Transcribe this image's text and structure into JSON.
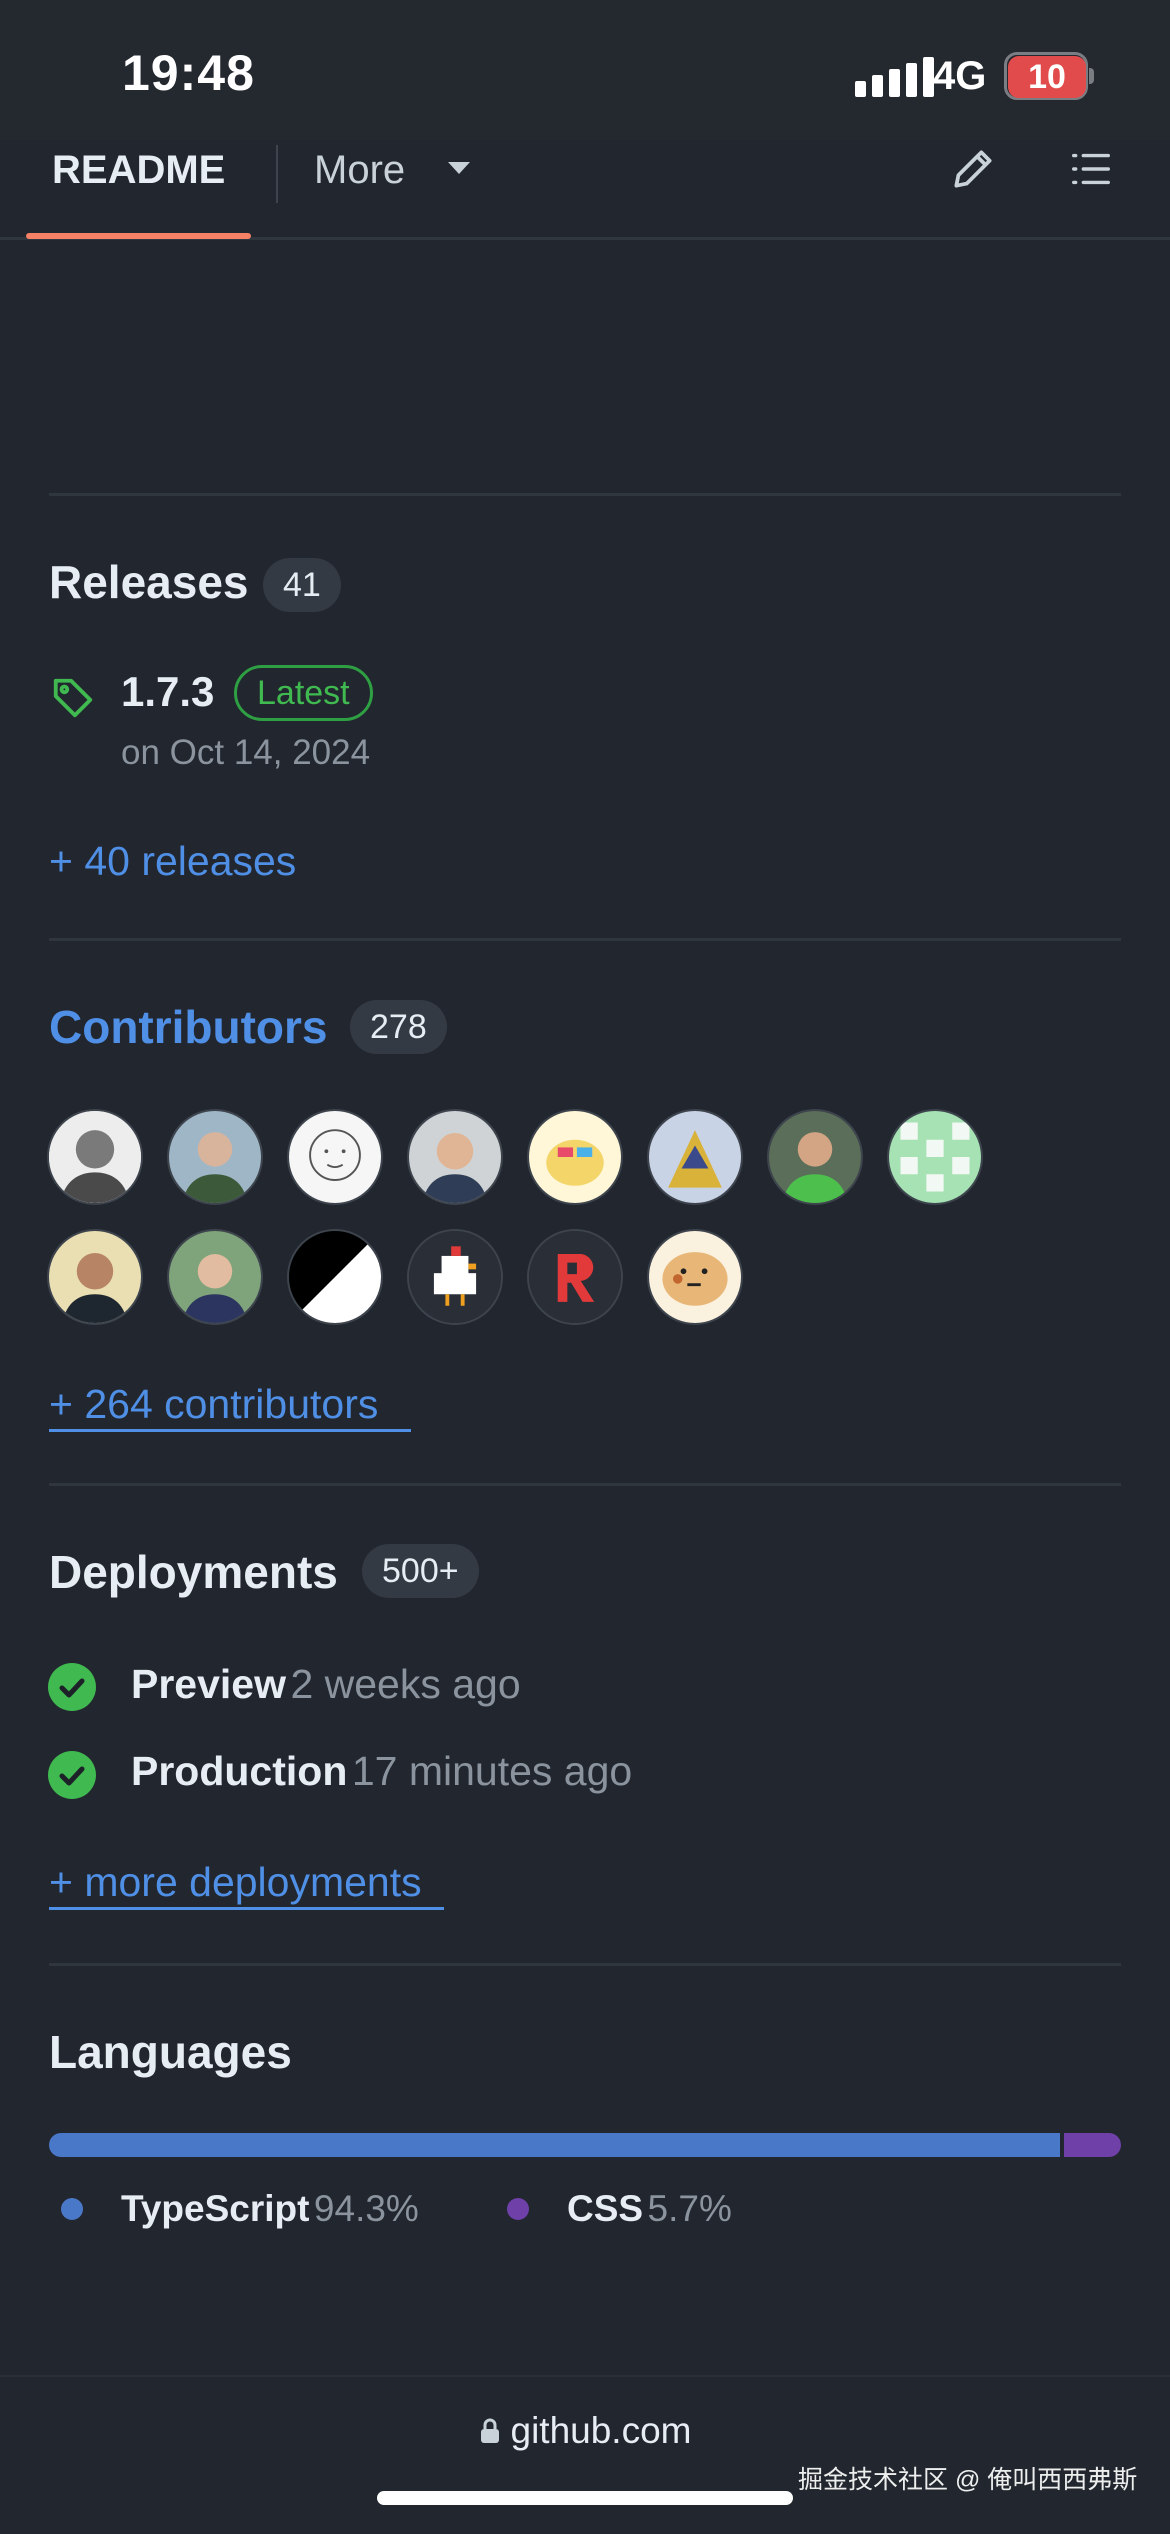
{
  "status_bar": {
    "time": "19:48",
    "network": "4G",
    "battery": "10"
  },
  "tabs": {
    "readme": "README",
    "more": "More"
  },
  "releases": {
    "title": "Releases",
    "count": "41",
    "latest_version": "1.7.3",
    "latest_badge": "Latest",
    "latest_date": "on Oct 14, 2024",
    "more_link": "+ 40 releases"
  },
  "contributors": {
    "title": "Contributors",
    "count": "278",
    "more_link": "+ 264 contributors"
  },
  "deployments": {
    "title": "Deployments",
    "count": "500+",
    "items": [
      {
        "name": "Preview",
        "time": "2 weeks ago",
        "status": "success"
      },
      {
        "name": "Production",
        "time": "17 minutes ago",
        "status": "success"
      }
    ],
    "more_link": "+ more deployments"
  },
  "languages": {
    "title": "Languages",
    "items": [
      {
        "name": "TypeScript",
        "percent": "94.3%",
        "fraction": 0.943,
        "color": "#3178c6"
      },
      {
        "name": "CSS",
        "percent": "5.7%",
        "fraction": 0.057,
        "color": "#663399"
      }
    ]
  },
  "browser": {
    "url": "github.com"
  },
  "watermark": "掘金技术社区 @ 俺叫西西弗斯",
  "colors": {
    "link": "#4f8fe6",
    "success": "#3fb950",
    "tab_accent": "#f78166"
  }
}
